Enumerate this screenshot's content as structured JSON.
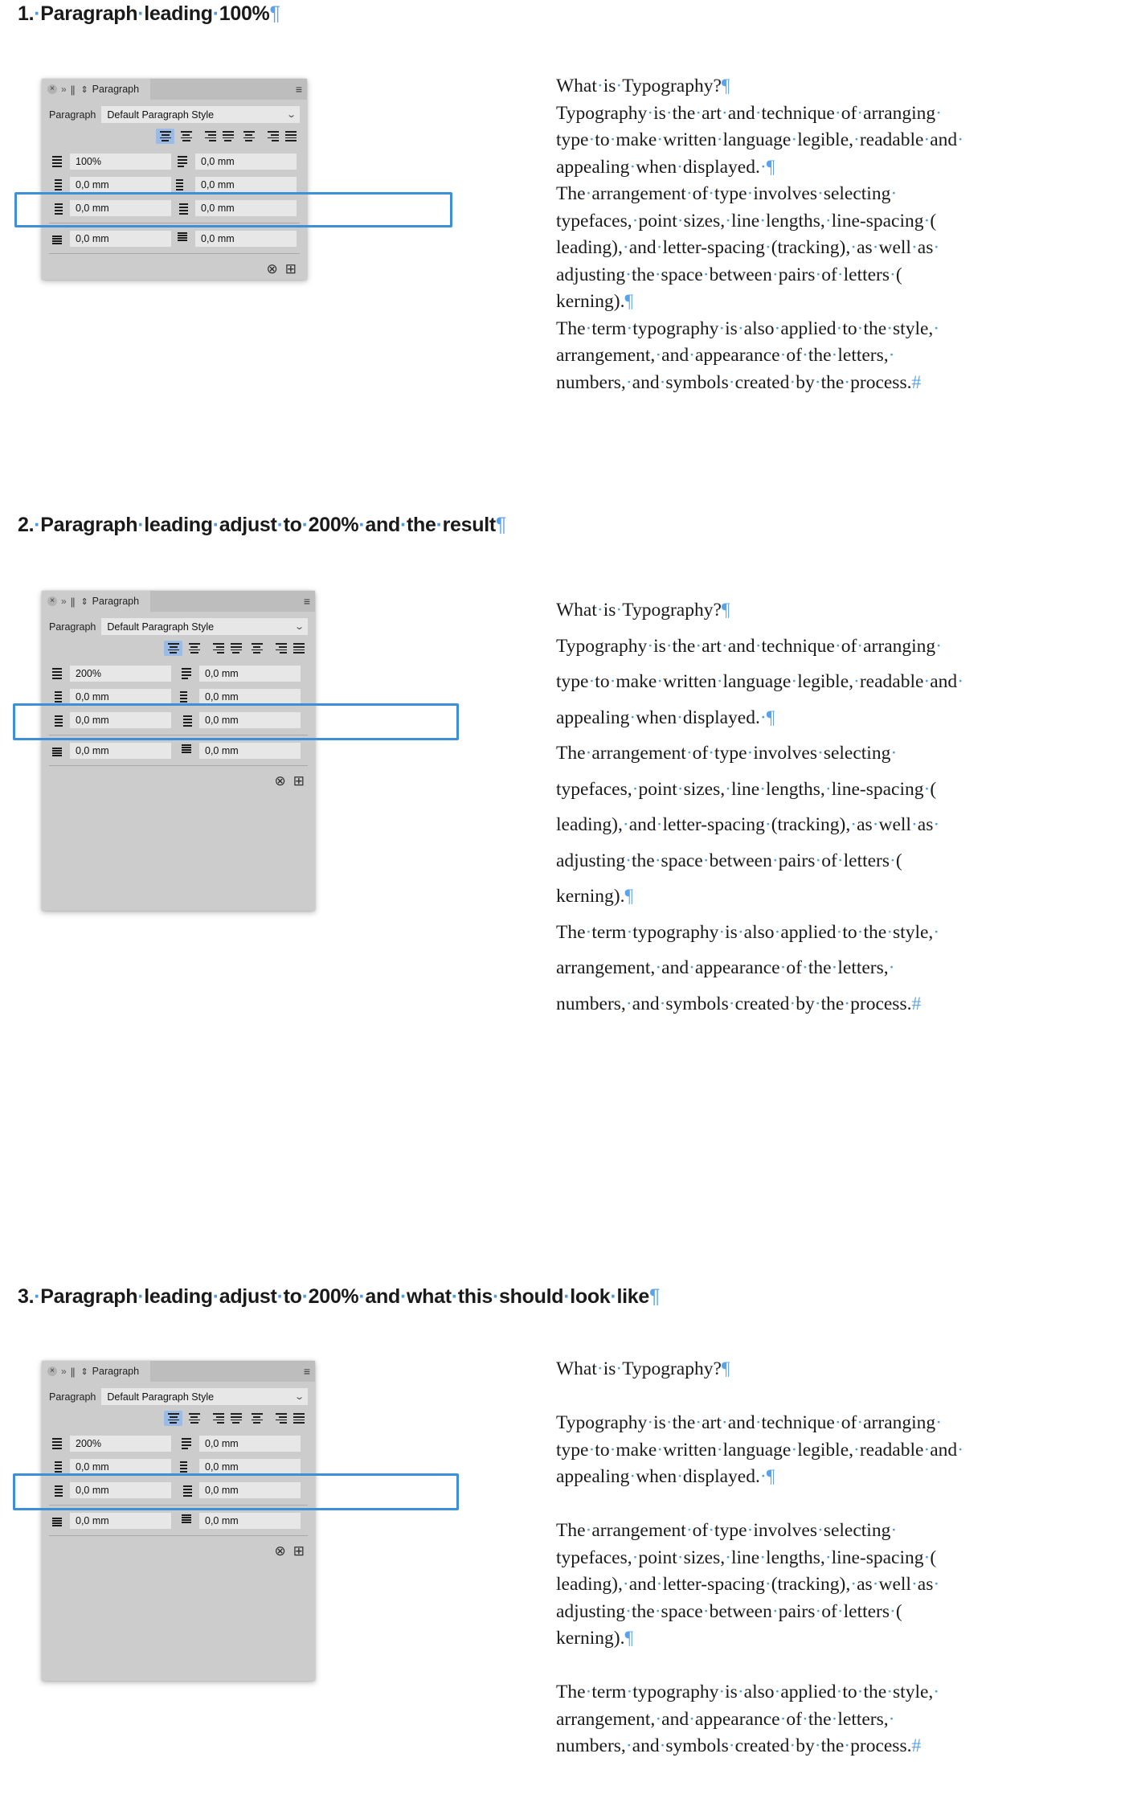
{
  "document": {
    "type": "InDesign Paragraph panel documentation",
    "space_dot": "·",
    "pilcrow": "¶",
    "end_mark": "#"
  },
  "sections": [
    {
      "number": "1.",
      "heading_words": [
        "Paragraph",
        "leading",
        "100%"
      ],
      "heading_plain": "1. Paragraph leading 100%",
      "leading_value": "100%",
      "text_leading_mode": "single"
    },
    {
      "number": "2.",
      "heading_words": [
        "Paragraph",
        "leading",
        "adjust",
        "to",
        "200%",
        "and",
        "the",
        "result"
      ],
      "heading_plain": "2. Paragraph leading adjust to 200% and the result",
      "leading_value": "200%",
      "text_leading_mode": "double"
    },
    {
      "number": "3.",
      "heading_words": [
        "Paragraph",
        "leading",
        "adjust",
        "to",
        "200%",
        "and",
        "what",
        "this",
        "should",
        "look",
        "like"
      ],
      "heading_plain": "3. Paragraph leading adjust to 200% and what this should look like",
      "leading_value": "200%",
      "text_leading_mode": "single-with-paragraph-space"
    }
  ],
  "panel": {
    "tab_title": "Paragraph",
    "close_icon": "×",
    "collapse_icon": "»",
    "grip_icon": "||",
    "sort_icon": "⇕",
    "menu_icon": "≡",
    "style_label": "Paragraph",
    "style_value": "Default Paragraph Style",
    "chevron_icon": "⌄",
    "align_buttons": [
      {
        "name": "align-left",
        "active": true
      },
      {
        "name": "align-center",
        "active": false
      },
      {
        "name": "align-right",
        "active": false
      },
      {
        "name": "justify-last-left",
        "active": false
      },
      {
        "name": "justify-last-center",
        "active": false
      },
      {
        "name": "justify-last-right",
        "active": false
      },
      {
        "name": "justify-all",
        "active": false
      }
    ],
    "fields": {
      "leading_100": "100%",
      "leading_200": "200%",
      "space_before_paragraph": "0,0 mm",
      "indent_left": "0,0 mm",
      "indent_right": "0,0 mm",
      "indent_first_line": "0,0 mm",
      "indent_last_line": "0,0 mm",
      "space_above": "0,0 mm",
      "space_below": "0,0 mm"
    },
    "footer_icons": {
      "clear_icon": "⊗",
      "add_icon": "⊞"
    }
  },
  "body_text": {
    "paragraphs": [
      {
        "id": "p1",
        "lines": [
          "What·is·Typography?¶"
        ]
      },
      {
        "id": "p2",
        "lines": [
          "Typography·is·the·art·and·technique·of·arranging·",
          "type·to·make·written·language·legible,·readable·and·",
          "appealing·when·displayed.·¶"
        ]
      },
      {
        "id": "p3",
        "lines": [
          "The·arrangement·of·type·involves·selecting·",
          "typefaces,·point·sizes,·line·lengths,·line-spacing·(",
          "leading),·and·letter-spacing·(tracking),·as·well·as·",
          "adjusting·the·space·between·pairs·of·letters·(",
          "kerning).¶"
        ]
      },
      {
        "id": "p4",
        "lines": [
          "The·term·typography·is·also·applied·to·the·style,·",
          "arrangement,·and·appearance·of·the·letters,·",
          "numbers,·and·symbols·created·by·the·process.#"
        ]
      }
    ]
  },
  "colors": {
    "accent_highlight": "#3d8fd8",
    "panel_background": "#cccccc",
    "panel_tabbar": "#bdbdbd",
    "field_background": "#e7e7e7",
    "align_active": "#9bbbe4",
    "invisible_char": "#5ba3e8",
    "text": "#1a1a1a"
  }
}
